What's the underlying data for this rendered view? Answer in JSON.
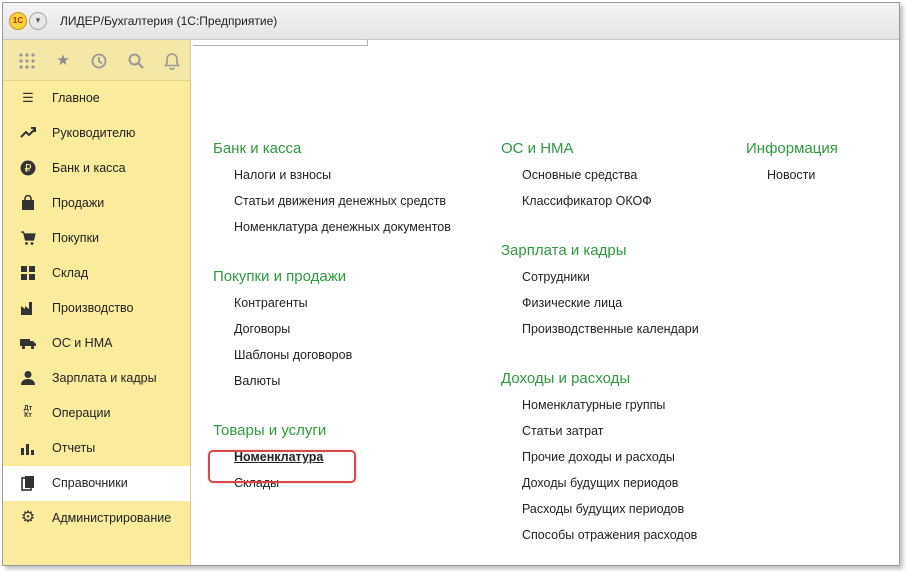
{
  "window": {
    "title": "ЛИДЕР/Бухгалтерия  (1С:Предприятие)",
    "logo_text": "1С"
  },
  "toolbar": {
    "icons": [
      "apps-grid-icon",
      "star-icon",
      "history-icon",
      "search-icon",
      "bell-icon"
    ]
  },
  "sidebar": {
    "items": [
      {
        "label": "Главное",
        "icon": "menu-lines-icon"
      },
      {
        "label": "Руководителю",
        "icon": "trend-icon"
      },
      {
        "label": "Банк и касса",
        "icon": "ruble-icon"
      },
      {
        "label": "Продажи",
        "icon": "bag-icon"
      },
      {
        "label": "Покупки",
        "icon": "cart-icon"
      },
      {
        "label": "Склад",
        "icon": "warehouse-icon"
      },
      {
        "label": "Производство",
        "icon": "factory-icon"
      },
      {
        "label": "ОС и НМА",
        "icon": "truck-icon"
      },
      {
        "label": "Зарплата и кадры",
        "icon": "person-icon"
      },
      {
        "label": "Операции",
        "icon": "dt-kt-icon",
        "glyph": "Дт Кт"
      },
      {
        "label": "Отчеты",
        "icon": "bar-chart-icon"
      },
      {
        "label": "Справочники",
        "icon": "books-icon",
        "active": true
      },
      {
        "label": "Администрирование",
        "icon": "gear-icon"
      }
    ]
  },
  "sections": {
    "col1": [
      {
        "title": "Банк и касса",
        "links": [
          "Налоги и взносы",
          "Статьи движения денежных средств",
          "Номенклатура денежных документов"
        ]
      },
      {
        "title": "Покупки и продажи",
        "links": [
          "Контрагенты",
          "Договоры",
          "Шаблоны договоров",
          "Валюты"
        ]
      },
      {
        "title": "Товары и услуги",
        "links": [
          "Номенклатура",
          "Склады"
        ]
      }
    ],
    "col2": [
      {
        "title": "ОС и НМА",
        "links": [
          "Основные средства",
          "Классификатор ОКОФ"
        ]
      },
      {
        "title": "Зарплата и кадры",
        "links": [
          "Сотрудники",
          "Физические лица",
          "Производственные календари"
        ]
      },
      {
        "title": "Доходы и расходы",
        "links": [
          "Номенклатурные группы",
          "Статьи затрат",
          "Прочие доходы и расходы",
          "Доходы будущих периодов",
          "Расходы будущих периодов",
          "Способы отражения расходов"
        ]
      }
    ],
    "col3": [
      {
        "title": "Информация",
        "links": [
          "Новости"
        ]
      }
    ]
  },
  "highlighted_link": "Номенклатура",
  "colors": {
    "sidebar_bg": "#fbec9d",
    "section_title": "#2f9a3c",
    "highlight_border": "#d9484b"
  }
}
